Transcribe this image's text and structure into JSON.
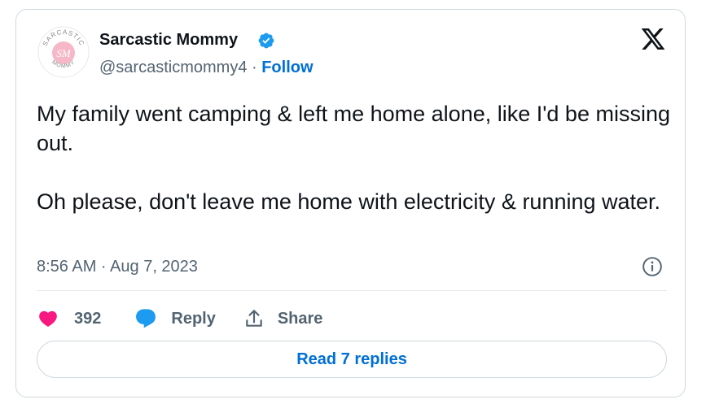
{
  "author": {
    "name": "Sarcastic Mommy",
    "handle": "@sarcasticmommy4",
    "separator": " · ",
    "follow_label": "Follow",
    "avatar_text": {
      "arc_top": "SARCASTIC",
      "arc_bottom": "MOMMY",
      "monogram": "SM"
    }
  },
  "tweet": {
    "paragraphs": [
      "My family went camping & left me home alone, like I'd be missing out.",
      "Oh please, don't leave me home with electricity & running water."
    ],
    "timestamp": "8:56 AM · Aug 7, 2023"
  },
  "actions": {
    "like_count": "392",
    "reply_label": "Reply",
    "share_label": "Share"
  },
  "footer": {
    "read_replies_label": "Read 7 replies"
  },
  "colors": {
    "link_blue": "#006fd6",
    "verified_blue": "#1d9bf0",
    "like_pink": "#f91880",
    "text_primary": "#0f1419",
    "text_secondary": "#536471",
    "border": "#cfd9de"
  },
  "icons": [
    "verified-badge-icon",
    "x-logo-icon",
    "info-icon",
    "heart-icon",
    "reply-bubble-icon",
    "share-icon"
  ]
}
